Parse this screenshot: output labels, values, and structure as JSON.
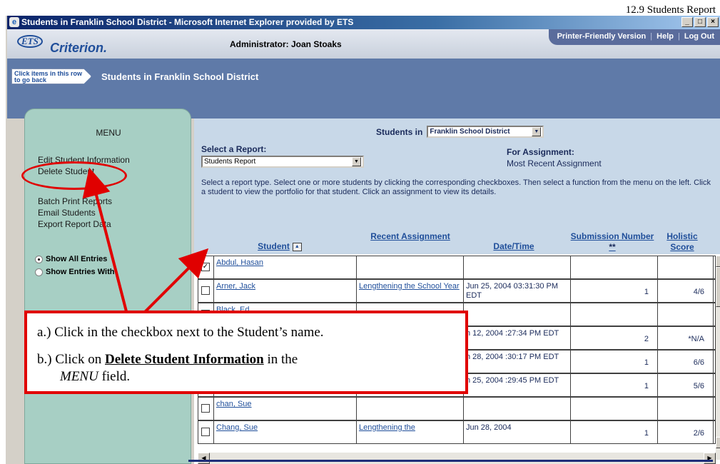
{
  "caption": "12.9 Students Report",
  "window": {
    "title": "Students in Franklin School District - Microsoft Internet Explorer provided by ETS",
    "buttons": [
      "_",
      "□",
      "×"
    ]
  },
  "header": {
    "logo_ets": "ETS",
    "logo_name": "Criterion.",
    "administrator": "Administrator: Joan Stoaks",
    "links": [
      "Printer-Friendly Version",
      "Help",
      "Log Out"
    ]
  },
  "breadcrumb": {
    "button": "Click items in this row to go back",
    "title": "Students in Franklin School District"
  },
  "menu": {
    "title": "MENU",
    "items": [
      "Edit Student Information",
      "Delete Student",
      "Batch Print Reports",
      "Email Students",
      "Export Report Data"
    ],
    "radios": [
      {
        "label": "Show All Entries",
        "selected": true
      },
      {
        "label": "Show Entries With:",
        "selected": false
      }
    ]
  },
  "report": {
    "students_in_label": "Students in",
    "district_select": "Franklin School District",
    "select_report_label": "Select a Report:",
    "report_select": "Students Report",
    "for_assignment_label": "For Assignment:",
    "for_assignment_value": "Most Recent Assignment",
    "instructions": "Select a report type. Select one or more students by clicking the corresponding checkboxes. Then select a function from the menu on the left. Click a student to view the portfolio for that student. Click an assignment to view its details.",
    "columns": {
      "student": "Student",
      "recent_assignment": "Recent Assignment",
      "date_time": "Date/Time",
      "submission_number": "Submission Number",
      "submission_suffix": "**",
      "holistic_score": "Holistic Score"
    },
    "rows": [
      {
        "checked": true,
        "student": "Abdul, Hasan",
        "assignment": "",
        "date": "",
        "submission": "",
        "score": ""
      },
      {
        "checked": false,
        "student": "Arner, Jack",
        "assignment": "Lengthening the School Year",
        "date": "Jun 25, 2004 03:31:30 PM EDT",
        "submission": "1",
        "score": "4/6"
      },
      {
        "checked": false,
        "student": "Black, Ed",
        "assignment": "",
        "date": "",
        "submission": "",
        "score": ""
      },
      {
        "checked": false,
        "student": "",
        "assignment": "",
        "date": "n 12, 2004 :27:34 PM EDT",
        "submission": "2",
        "score": "*N/A"
      },
      {
        "checked": false,
        "student": "",
        "assignment": "",
        "date": "n 28, 2004 :30:17 PM EDT",
        "submission": "1",
        "score": "6/6"
      },
      {
        "checked": false,
        "student": "",
        "assignment": "",
        "date": "n 25, 2004 :29:45 PM EDT",
        "submission": "1",
        "score": "5/6"
      },
      {
        "checked": false,
        "student": "chan, Sue",
        "assignment": "",
        "date": "",
        "submission": "",
        "score": ""
      },
      {
        "checked": false,
        "student": "Chang, Sue",
        "assignment": "Lengthening the",
        "date": "Jun 28, 2004",
        "submission": "1",
        "score": "2/6"
      }
    ]
  },
  "callout": {
    "line_a": "a.)  Click in the checkbox next to the Student’s name.",
    "line_b_pre": "b.)  Click on ",
    "line_b_bold": "Delete Student Information",
    "line_b_post": " in the",
    "line_c_italic": "MENU",
    "line_c_post": " field."
  }
}
